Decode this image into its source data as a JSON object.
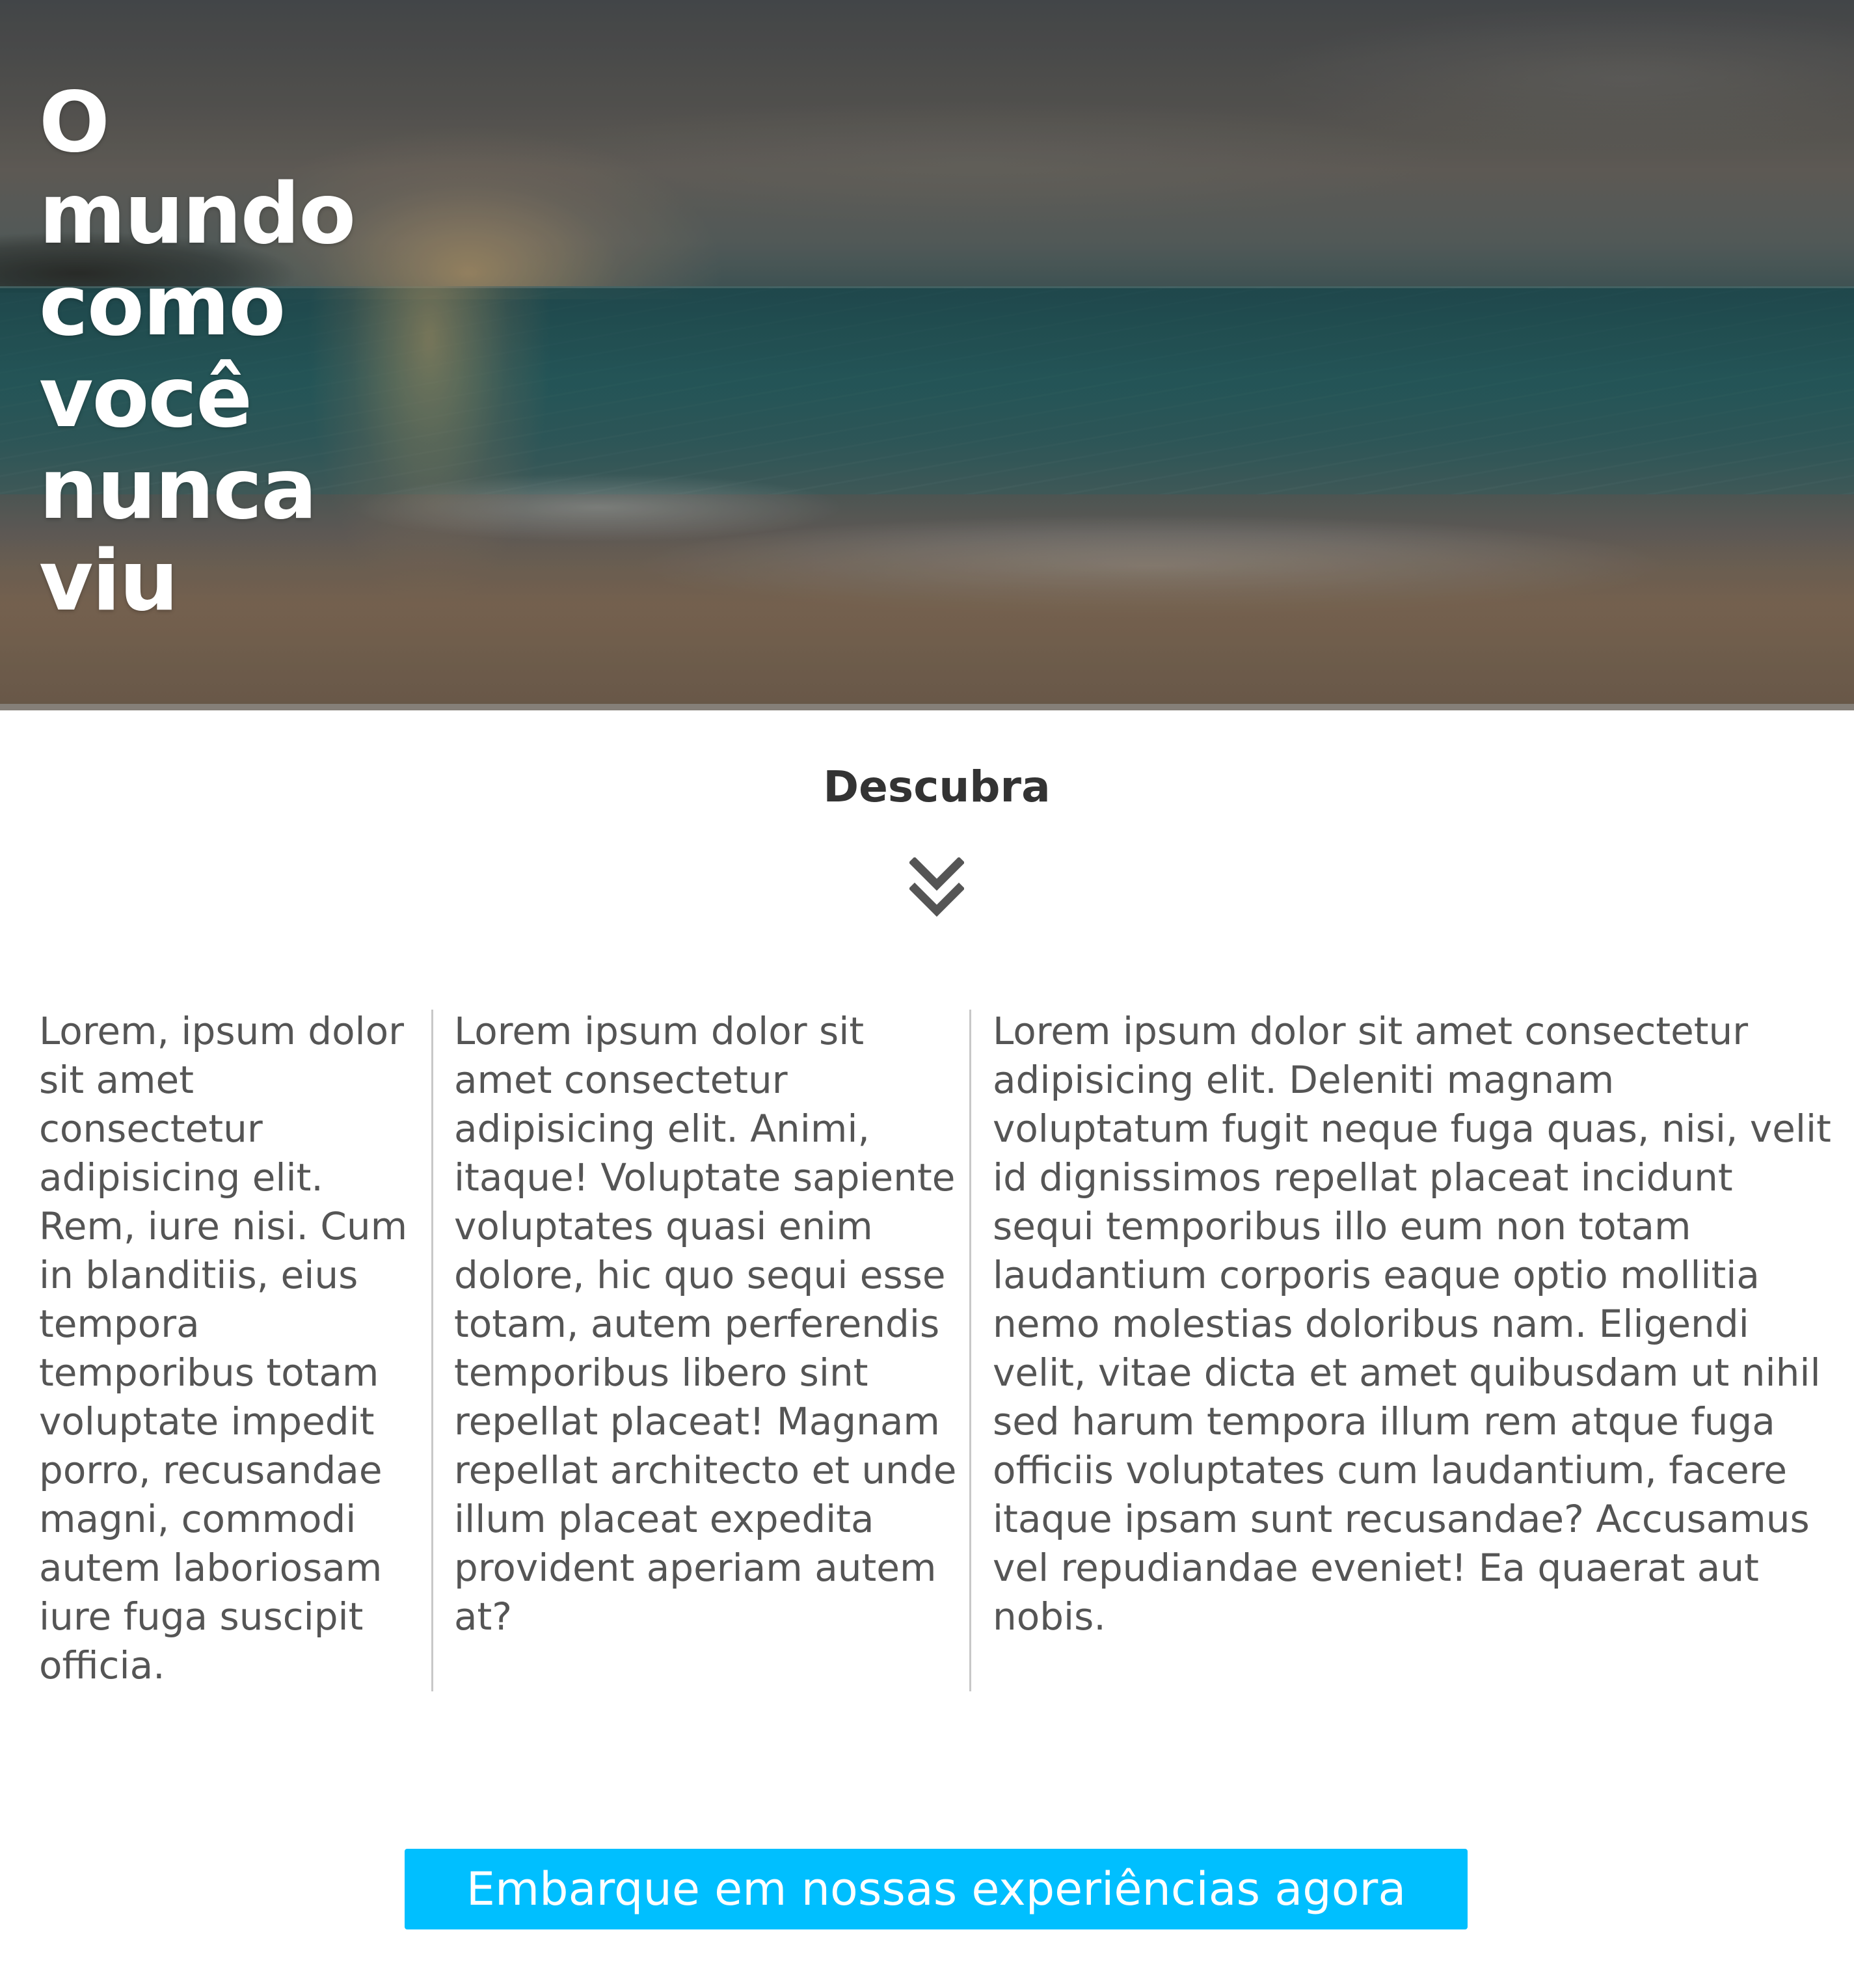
{
  "hero": {
    "title": "O mundo como você nunca viu"
  },
  "discover": {
    "label": "Descubra",
    "icon": "double-chevron-down-icon"
  },
  "columns": [
    {
      "text": "Lorem, ipsum dolor sit amet consectetur adipisicing elit. Rem, iure nisi. Cum in blanditiis, eius tempora temporibus totam voluptate impedit porro, recusandae magni, commodi autem laboriosam iure fuga suscipit officia."
    },
    {
      "text": "Lorem ipsum dolor sit amet consectetur adipisicing elit. Animi, itaque! Voluptate sapiente voluptates quasi enim dolore, hic quo sequi esse totam, autem perferendis temporibus libero sint repellat placeat! Magnam repellat architecto et unde illum placeat expedita provident aperiam autem at?"
    },
    {
      "text": "Lorem ipsum dolor sit amet consectetur adipisicing elit. Deleniti magnam voluptatum fugit neque fuga quas, nisi, velit id dignissimos repellat placeat incidunt sequi temporibus illo eum non totam laudantium corporis eaque optio mollitia nemo molestias doloribus nam. Eligendi velit, vitae dicta et amet quibusdam ut nihil sed harum tempora illum rem atque fuga officiis voluptates cum laudantium, facere itaque ipsam sunt recusandae? Accusamus vel repudiandae eveniet! Ea quaerat aut nobis."
    }
  ],
  "cta": {
    "label": "Embarque em nossas experiências agora"
  },
  "colors": {
    "accent": "#00bfff",
    "heading": "#333333",
    "body_text": "#555555",
    "divider": "#c8c8c8"
  }
}
